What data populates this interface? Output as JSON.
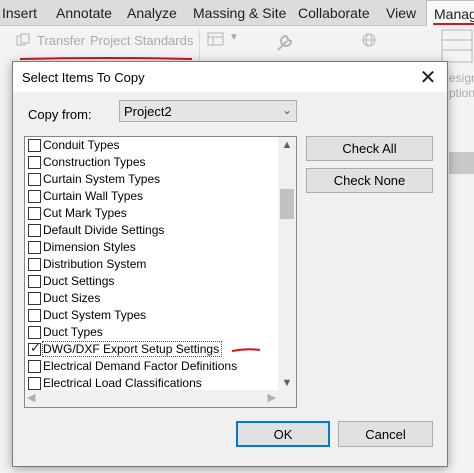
{
  "ribbon": {
    "tabs": [
      {
        "label": "Insert"
      },
      {
        "label": "Annotate"
      },
      {
        "label": "Analyze"
      },
      {
        "label": "Massing & Site"
      },
      {
        "label": "Collaborate"
      },
      {
        "label": "View"
      },
      {
        "label": "Manag"
      }
    ],
    "transfer_label": "Transfer",
    "project_standards_label": "Project Standards",
    "design_label": "esign",
    "options_label": "ptions",
    "annotation_color": "#d0161a"
  },
  "dialog": {
    "title": "Select Items To Copy",
    "copy_from_label": "Copy from:",
    "copy_from_value": "Project2",
    "items": [
      {
        "label": "Conduit Types",
        "checked": false
      },
      {
        "label": "Construction Types",
        "checked": false
      },
      {
        "label": "Curtain System Types",
        "checked": false
      },
      {
        "label": "Curtain Wall Types",
        "checked": false
      },
      {
        "label": "Cut Mark Types",
        "checked": false
      },
      {
        "label": "Default Divide Settings",
        "checked": false
      },
      {
        "label": "Dimension Styles",
        "checked": false
      },
      {
        "label": "Distribution System",
        "checked": false
      },
      {
        "label": "Duct Settings",
        "checked": false
      },
      {
        "label": "Duct Sizes",
        "checked": false
      },
      {
        "label": "Duct System Types",
        "checked": false
      },
      {
        "label": "Duct Types",
        "checked": false
      },
      {
        "label": "DWG/DXF Export Setup Settings",
        "checked": true
      },
      {
        "label": "Electrical Demand Factor Definitions",
        "checked": false
      },
      {
        "label": "Electrical Load Classifications",
        "checked": false
      }
    ],
    "buttons": {
      "check_all": "Check All",
      "check_none": "Check None",
      "ok": "OK",
      "cancel": "Cancel"
    },
    "accent_color": "#0078d7"
  }
}
